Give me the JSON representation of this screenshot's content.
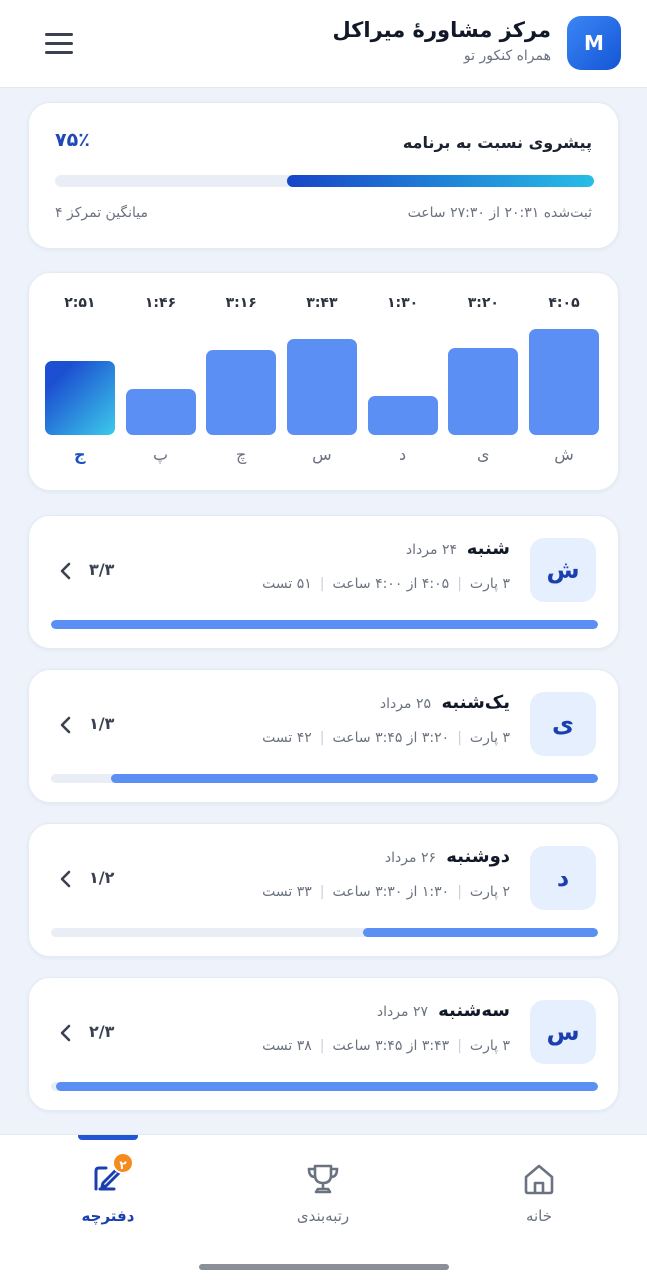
{
  "header": {
    "logo_letter": "M",
    "title": "مرکز مشاورهٔ میراکل",
    "subtitle": "همراه کنکور تو"
  },
  "progress": {
    "title": "پیشروی نسبت به برنامه",
    "percent_text": "۷۵٪",
    "percent": 75,
    "recorded_text": "ثبت‌شده ۲۰:۳۱ از ۲۷:۳۰ ساعت",
    "focus_text": "میانگین تمرکز ۴"
  },
  "weekly_chart": {
    "bars": [
      {
        "day": "ش",
        "time": "۴:۰۵",
        "minutes": 245,
        "today": false
      },
      {
        "day": "ی",
        "time": "۳:۲۰",
        "minutes": 200,
        "today": false
      },
      {
        "day": "د",
        "time": "۱:۳۰",
        "minutes": 90,
        "today": false
      },
      {
        "day": "س",
        "time": "۳:۴۳",
        "minutes": 223,
        "today": false
      },
      {
        "day": "چ",
        "time": "۳:۱۶",
        "minutes": 196,
        "today": false
      },
      {
        "day": "پ",
        "time": "۱:۴۶",
        "minutes": 106,
        "today": false
      },
      {
        "day": "ج",
        "time": "۲:۵۱",
        "minutes": 171,
        "today": true
      }
    ]
  },
  "days": [
    {
      "badge": "ش",
      "name": "شنبه",
      "date": "۲۴ مرداد",
      "parts": "۳ پارت",
      "hours": "۴:۰۵ از ۴:۰۰ ساعت",
      "tests": "۵۱ تست",
      "count": "۳/۳",
      "progress": 1.0
    },
    {
      "badge": "ی",
      "name": "یک‌شنبه",
      "date": "۲۵ مرداد",
      "parts": "۳ پارت",
      "hours": "۳:۲۰ از ۳:۴۵ ساعت",
      "tests": "۴۲ تست",
      "count": "۱/۳",
      "progress": 0.89
    },
    {
      "badge": "د",
      "name": "دوشنبه",
      "date": "۲۶ مرداد",
      "parts": "۲ پارت",
      "hours": "۱:۳۰ از ۳:۳۰ ساعت",
      "tests": "۳۳ تست",
      "count": "۱/۲",
      "progress": 0.43
    },
    {
      "badge": "س",
      "name": "سه‌شنبه",
      "date": "۲۷ مرداد",
      "parts": "۳ پارت",
      "hours": "۳:۴۳ از ۳:۴۵ ساعت",
      "tests": "۳۸ تست",
      "count": "۲/۳",
      "progress": 0.99
    }
  ],
  "nav": {
    "home": "خانه",
    "ranking": "رتبه‌بندی",
    "notebook": "دفترچه",
    "notebook_badge": "۲"
  }
}
